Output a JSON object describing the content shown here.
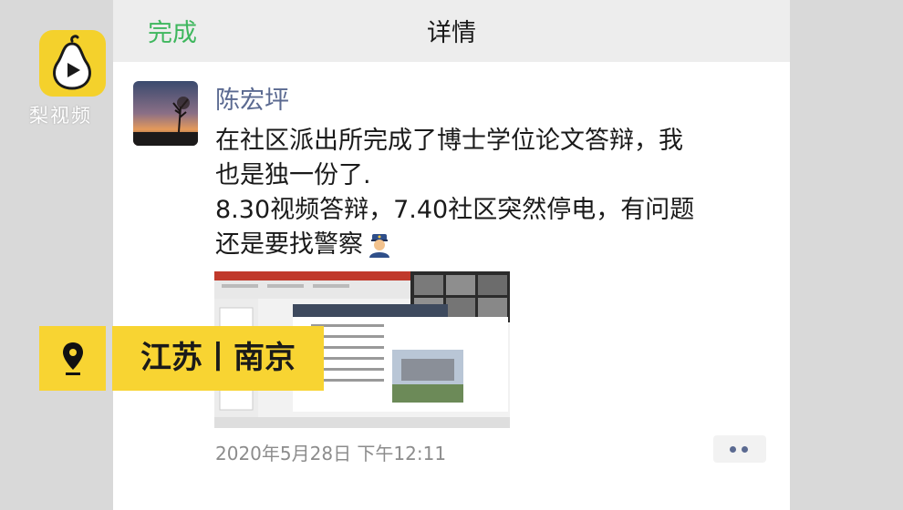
{
  "watermark": {
    "brand": "梨视频",
    "icon": "pear-play-icon"
  },
  "nav": {
    "done": "完成",
    "title": "详情"
  },
  "post": {
    "author": "陈宏坪",
    "lines": [
      "在社区派出所完成了博士学位论文答辩，我",
      "也是独一份了.",
      "8.30视频答辩，7.40社区突然停电，有问题",
      "还是要找警察"
    ],
    "emoji": "police-officer-emoji",
    "timestamp": "2020年5月28日 下午12:11",
    "more_icon": "two-dots-icon"
  },
  "location": {
    "icon": "location-pin-icon",
    "label": "江苏丨南京"
  },
  "colors": {
    "brand_yellow": "#F8D432",
    "wechat_green": "#3FB75E",
    "author_blue": "#5B6A91"
  }
}
